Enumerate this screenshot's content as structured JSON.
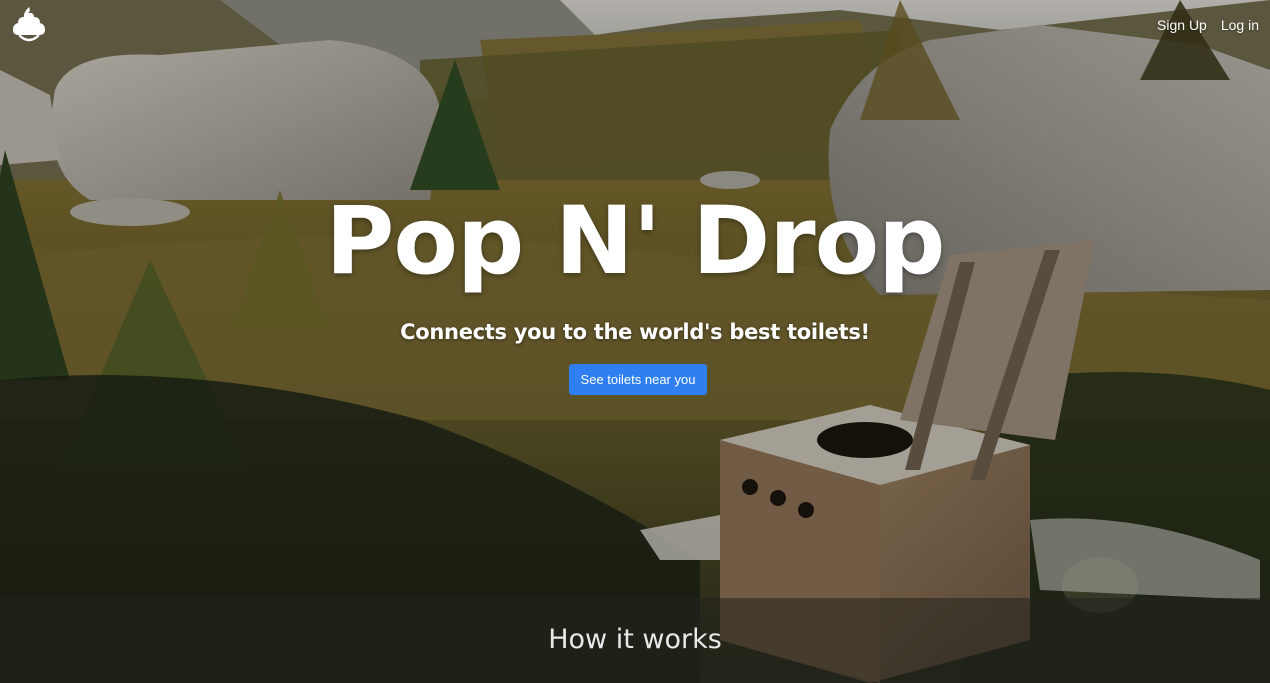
{
  "nav": {
    "logo_icon": "poop-icon",
    "signup_label": "Sign Up",
    "login_label": "Log in"
  },
  "hero": {
    "title": "Pop N' Drop",
    "subtitle": "Connects you to the world's best toilets!",
    "cta_label": "See toilets near you",
    "background": "photo of an outdoor wooden toilet box in an alpine meadow with boulders and larch trees"
  },
  "section": {
    "how_title": "How it works"
  },
  "colors": {
    "cta_background": "#2f7ff0",
    "text": "#ffffff"
  }
}
